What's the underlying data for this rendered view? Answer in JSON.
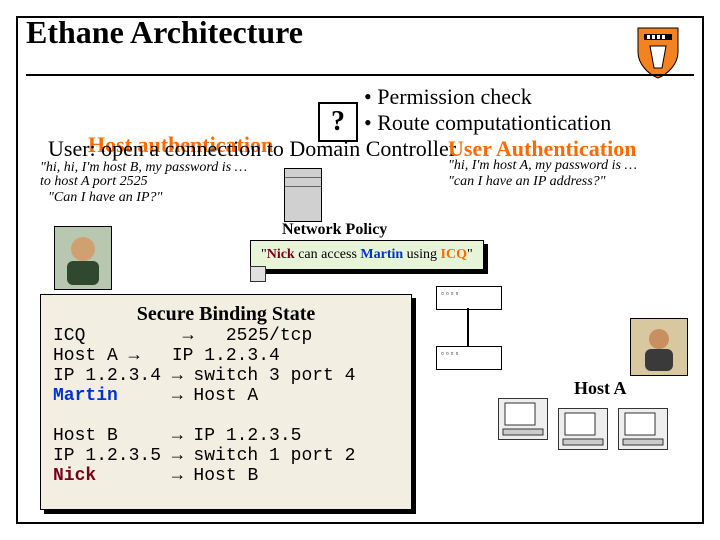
{
  "title": "Ethane Architecture",
  "checks": {
    "a": "• Permission check",
    "b1": "• Route computation",
    "b2": "tication"
  },
  "overlap_left_1": "Host  authentication",
  "overlap_left_2": "User: open a connection to   Domain Controller",
  "user_auth": "User  Authentication",
  "small_lines": {
    "l1": "\"hi, hi, I'm host B, my password is …",
    "l2": "  to host A  port 2525",
    "l3": "  \"Can I have an IP?\"",
    "r1": "\"hi, I'm host A, my password is …",
    "r2": "\"can I have an IP address?\""
  },
  "question_mark": "?",
  "netpolicy": {
    "label": "Network Policy",
    "rule_pre": "\"",
    "rule_nick": "Nick",
    "rule_mid1": " can access ",
    "rule_martin": "Martin",
    "rule_mid2": " using ",
    "rule_icq": "ICQ",
    "rule_post": "\""
  },
  "binding": {
    "header": "Secure Binding State",
    "body1": "ICQ         →   2525/tcp\nHost A →   IP 1.2.3.4\nIP 1.2.3.4 → switch 3 port 4",
    "martin": "Martin",
    "martin_map": "     → Host A",
    "body2": "\nHost B     → IP 1.2.3.5\nIP 1.2.3.5 → switch 1 port 2",
    "nick": "Nick       ",
    "nick_map": "→ Host B"
  },
  "hostA_label": "Host A",
  "switch_ports": "▫▫▫▫",
  "colors": {
    "orange": "#ff6a00",
    "maroon": "#7a0019",
    "blue": "#0033cc"
  }
}
